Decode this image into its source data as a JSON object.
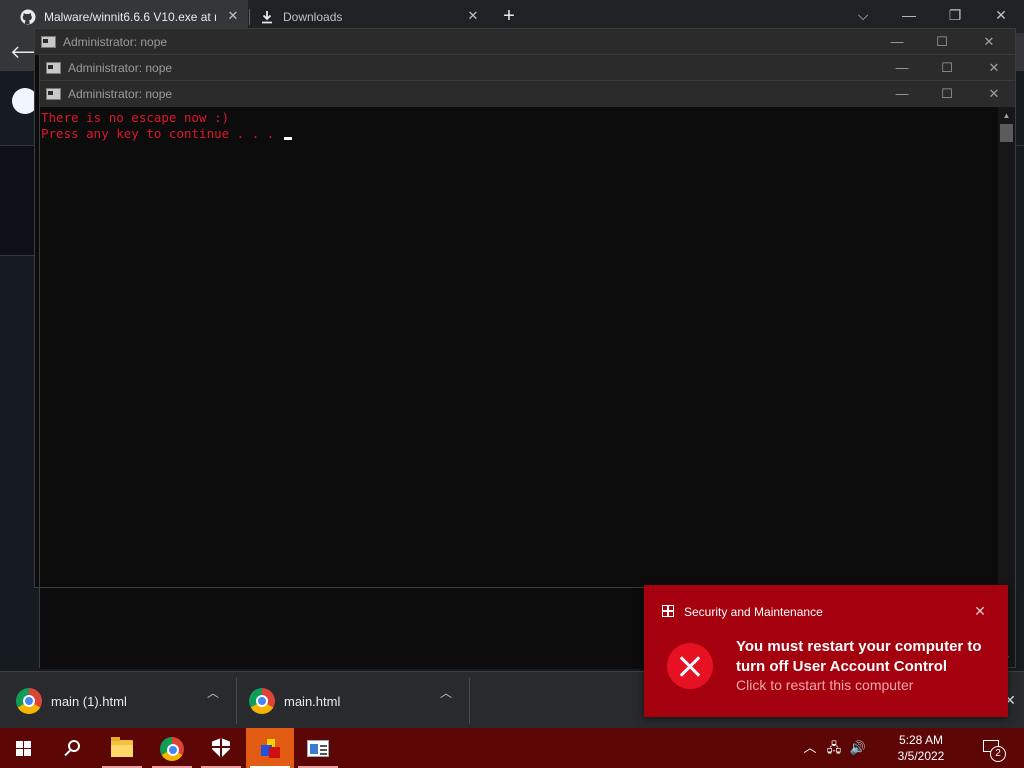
{
  "browser": {
    "tabs": [
      {
        "label": "Malware/winnit6.6.6 V10.exe at m",
        "icon": "github-icon",
        "active": true
      },
      {
        "label": "Downloads",
        "icon": "download-icon",
        "active": false
      }
    ],
    "new_tab": "+"
  },
  "consoles": [
    {
      "title": "Administrator:  nope"
    },
    {
      "title": "Administrator:  nope"
    },
    {
      "title": "Administrator:  nope"
    }
  ],
  "console_output": {
    "line1": "There is no escape now :)",
    "line2": "Press any key to continue . . . "
  },
  "downloads_bar": {
    "items": [
      {
        "label": "main (1).html"
      },
      {
        "label": "main.html"
      }
    ]
  },
  "toast": {
    "app_name": "Security and Maintenance",
    "title": "You must restart your computer to turn off User Account Control",
    "subtitle": "Click to restart this computer",
    "background": "#a4000d"
  },
  "taskbar": {
    "background": "#5d0606",
    "clock_time": "5:28 AM",
    "clock_date": "3/5/2022",
    "notification_count": "2"
  }
}
